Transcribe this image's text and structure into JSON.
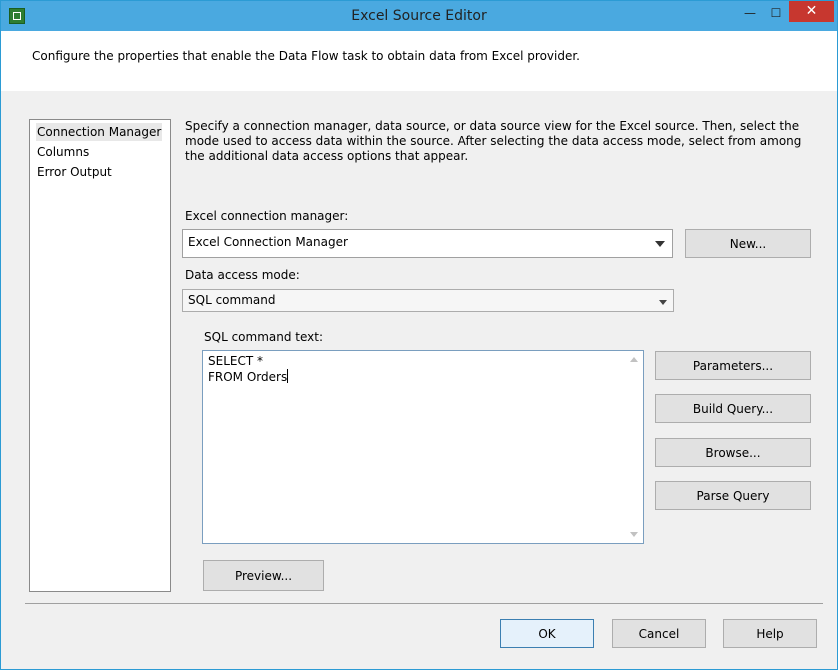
{
  "window": {
    "title": "Excel Source Editor",
    "minimize_glyph": "—",
    "maximize_glyph": "☐",
    "close_glyph": "✕"
  },
  "header": {
    "text": "Configure the properties that enable the Data Flow task to obtain data from Excel provider."
  },
  "nav": {
    "items": [
      "Connection Manager",
      "Columns",
      "Error Output"
    ],
    "selected": "Connection Manager"
  },
  "main": {
    "description": "Specify a connection manager, data source, or data source view for the Excel source. Then, select the mode used to access data within the source. After selecting the data access mode, select from among the additional data access options that appear.",
    "connection_label": "Excel connection manager:",
    "connection_value": "Excel Connection Manager",
    "new_button": "New...",
    "access_mode_label": "Data access mode:",
    "access_mode_value": "SQL command",
    "sql_label": "SQL command text:",
    "sql_lines": [
      "SELECT *",
      "FROM Orders"
    ],
    "parameters_button": "Parameters...",
    "build_query_button": "Build Query...",
    "browse_button": "Browse...",
    "parse_query_button": "Parse Query",
    "preview_button": "Preview..."
  },
  "footer": {
    "ok": "OK",
    "cancel": "Cancel",
    "help": "Help"
  },
  "colors": {
    "titlebar": "#4aa9e0",
    "close_button": "#c7372f",
    "default_button_border": "#3c7fb1"
  }
}
